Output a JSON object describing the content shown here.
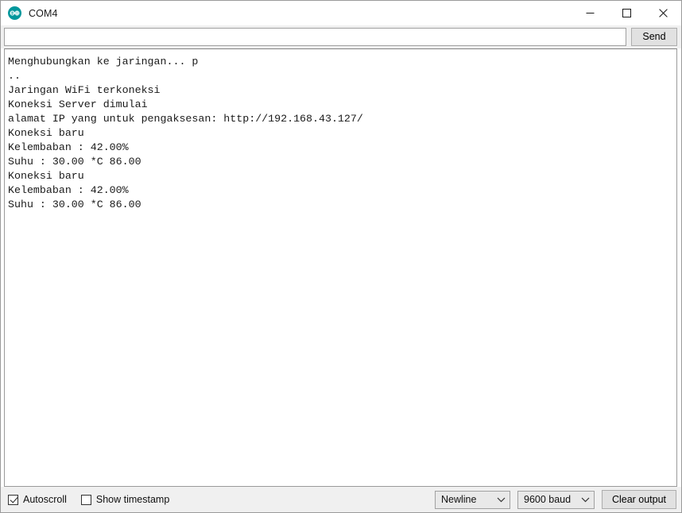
{
  "window": {
    "title": "COM4",
    "icon": "arduino-logo-icon",
    "controls": {
      "minimize_label": "minimize-icon",
      "maximize_label": "maximize-icon",
      "close_label": "close-icon"
    }
  },
  "send_row": {
    "input_value": "",
    "input_placeholder": "",
    "send_label": "Send"
  },
  "console": {
    "lines": [
      "Menghubungkan ke jaringan... p",
      "..",
      "Jaringan WiFi terkoneksi",
      "Koneksi Server dimulai",
      "alamat IP yang untuk pengaksesan: http://192.168.43.127/",
      "Koneksi baru",
      "Kelembaban : 42.00%",
      "Suhu : 30.00 *C 86.00",
      "Koneksi baru",
      "Kelembaban : 42.00%",
      "Suhu : 30.00 *C 86.00"
    ],
    "text": "Menghubungkan ke jaringan... p\n..\nJaringan WiFi terkoneksi\nKoneksi Server dimulai\nalamat IP yang untuk pengaksesan: http://192.168.43.127/\nKoneksi baru\nKelembaban : 42.00%\nSuhu : 30.00 *C 86.00\nKoneksi baru\nKelembaban : 42.00%\nSuhu : 30.00 *C 86.00"
  },
  "status_bar": {
    "autoscroll_label": "Autoscroll",
    "autoscroll_checked": true,
    "timestamp_label": "Show timestamp",
    "timestamp_checked": false,
    "line_ending_value": "Newline",
    "baud_value": "9600 baud",
    "clear_label": "Clear output"
  },
  "colors": {
    "accent": "#00979c",
    "window_bg": "#ffffff",
    "chrome_bg": "#f0f0f0",
    "border": "#9a9a9a",
    "text": "#1a1a1a"
  }
}
